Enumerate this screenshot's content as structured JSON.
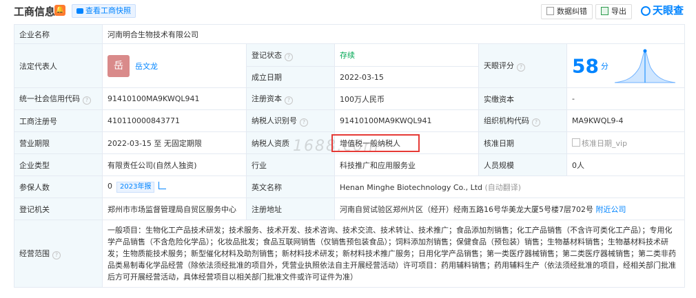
{
  "header": {
    "title": "工商信息",
    "snapshot_label": "查看工商快照",
    "report_error_label": "数据纠错",
    "export_label": "导出",
    "logo_text": "天眼查"
  },
  "company": {
    "name_label": "企业名称",
    "name": "河南明合生物技术有限公司",
    "legal_rep_label": "法定代表人",
    "legal_rep_avatar": "岳",
    "legal_rep": "岳文龙",
    "status_label": "登记状态",
    "status": "存续",
    "founded_label": "成立日期",
    "founded": "2022-03-15",
    "score_label": "天眼评分",
    "score": "58",
    "score_unit": "分",
    "credit_code_label": "统一社会信用代码",
    "credit_code": "91410100MA9KWQL941",
    "reg_capital_label": "注册资本",
    "reg_capital": "100万人民币",
    "paid_capital_label": "实缴资本",
    "paid_capital": "-",
    "reg_no_label": "工商注册号",
    "reg_no": "410110000843771",
    "taxpayer_id_label": "纳税人识别号",
    "taxpayer_id": "91410100MA9KWQL941",
    "org_code_label": "组织机构代码",
    "org_code": "MA9KWQL9-4",
    "term_label": "营业期限",
    "term": "2022-03-15 至 无固定期限",
    "taxpayer_qual_label": "纳税人资质",
    "taxpayer_qual": "增值税一般纳税人",
    "approve_date_label": "核准日期",
    "approve_date": "核准日期_vip",
    "type_label": "企业类型",
    "type": "有限责任公司(自然人独资)",
    "industry_label": "行业",
    "industry": "科技推广和应用服务业",
    "staff_label": "人员规模",
    "staff": "0人",
    "insured_label": "参保人数",
    "insured": "0",
    "insured_year": "2023年报",
    "en_name_label": "英文名称",
    "en_name": "Henan Minghe Biotechnology Co., Ltd",
    "en_name_note": "(自动翻译)",
    "authority_label": "登记机关",
    "authority": "郑州市市场监督管理局自贸区服务中心",
    "address_label": "注册地址",
    "address": "河南自贸试验区郑州片区（经开）经南五路16号华美龙大厦5号楼7层702号",
    "nearby_label": "附近公司",
    "scope_label": "经营范围",
    "scope": "一般项目：生物化工产品技术研发；技术服务、技术开发、技术咨询、技术交流、技术转让、技术推广；食品添加剂销售；化工产品销售（不含许可类化工产品）；专用化学产品销售（不含危险化学品）；化妆品批发；食品互联网销售（仅销售预包装食品）；饲料添加剂销售；保健食品（预包装）销售；生物基材料销售；生物基材料技术研发；生物质能技术服务；新型催化材料及助剂销售；新材料技术研发；新材料技术推广服务；日用化学产品销售；第一类医疗器械销售；第二类医疗器械销售；第二类非药品类易制毒化学品经营（除依法须经批准的项目外，凭营业执照依法自主开展经营活动）许可项目：药用辅料销售；药用辅料生产（依法须经批准的项目，经相关部门批准后方可开展经营活动，具体经营项目以相关部门批准文件或许可证件为准）"
  },
  "watermark": "1688.com",
  "colors": {
    "accent": "#0084ff",
    "key_bg": "#f2f9fc",
    "status_green": "#00a854",
    "highlight_red": "#e53935"
  }
}
